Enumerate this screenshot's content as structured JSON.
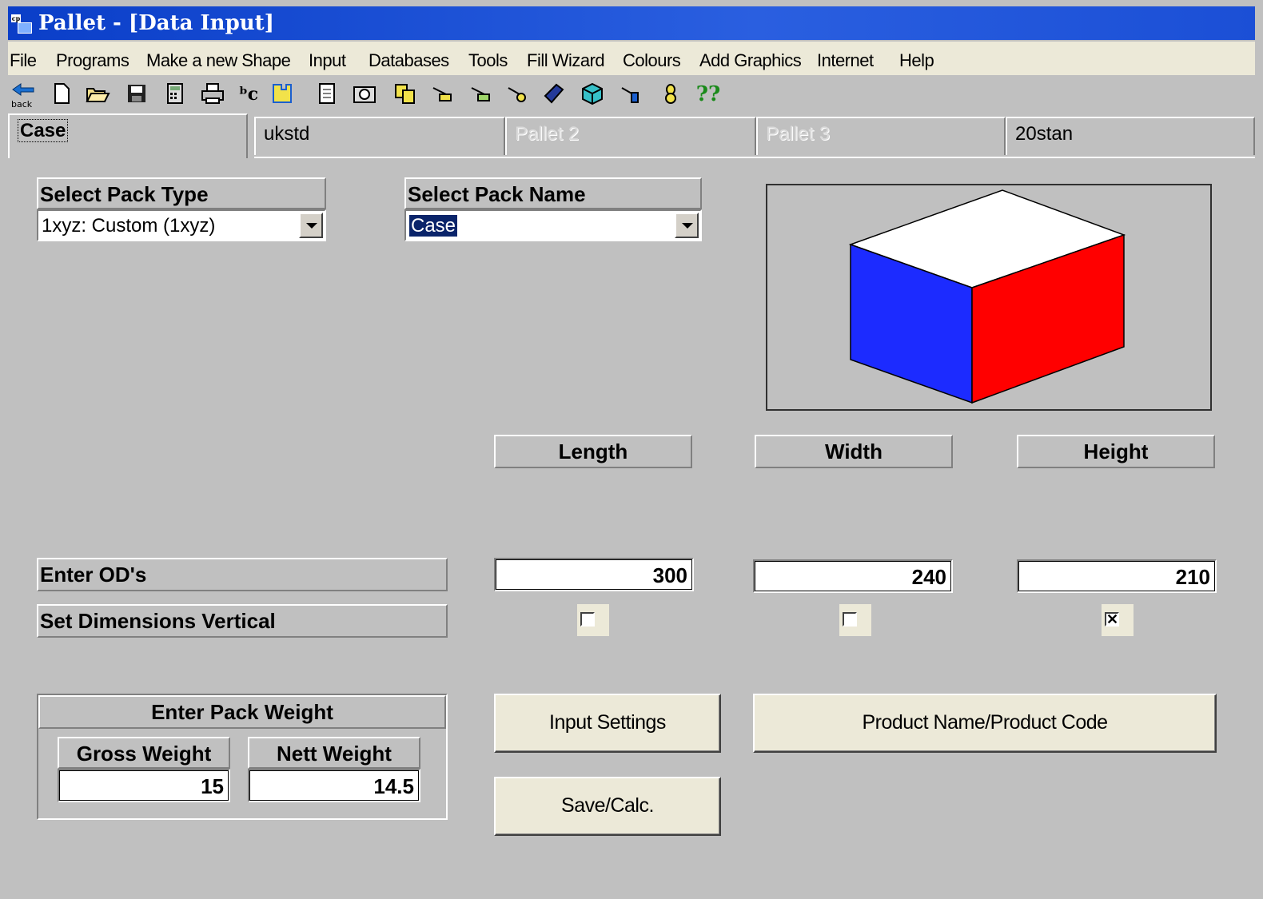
{
  "window": {
    "title": "Pallet - [Data Input]",
    "app_icon_text": "cp"
  },
  "menu": [
    "File",
    "Programs",
    "Make a new Shape",
    "Input",
    "Databases",
    "Tools",
    "Fill Wizard",
    "Colours",
    "Add Graphics",
    "Internet",
    "Help"
  ],
  "toolbar": {
    "back_label": "back",
    "icons": [
      "new-file-icon",
      "open-folder-icon",
      "save-disk-icon",
      "calculator-icon",
      "print-icon",
      "spell-abc-icon",
      "puzzle-icon",
      "document-icon",
      "camera-icon",
      "copy-icon",
      "pallet-tool-icon",
      "pallet-tool-2-icon",
      "pallet-tool-3-icon",
      "book-icon",
      "box-3d-icon",
      "pallet-tool-4-icon",
      "bottle-icon",
      "help-icon"
    ],
    "help_text": "??"
  },
  "tabs": [
    {
      "label": "Case",
      "state": "active"
    },
    {
      "label": "ukstd",
      "state": "normal"
    },
    {
      "label": "Pallet 2",
      "state": "disabled"
    },
    {
      "label": "Pallet 3",
      "state": "disabled"
    },
    {
      "label": "20stan",
      "state": "normal"
    }
  ],
  "pack_type": {
    "header": "Select Pack Type",
    "value": "1xyz:  Custom (1xyz)"
  },
  "pack_name": {
    "header": "Select Pack Name",
    "value": "Case"
  },
  "preview_colors": {
    "top": "#ffffff",
    "left": "#1c2bff",
    "right": "#ff0000"
  },
  "dimensions": {
    "headers": [
      "Length",
      "Width",
      "Height"
    ],
    "od_label": "Enter OD's",
    "od_values": [
      "300",
      "240",
      "210"
    ],
    "vertical_label": "Set Dimensions Vertical",
    "vertical_checked": [
      false,
      false,
      true
    ]
  },
  "weight": {
    "header": "Enter Pack Weight",
    "gross_label": "Gross Weight",
    "gross_value": "15",
    "nett_label": "Nett Weight",
    "nett_value": "14.5"
  },
  "buttons": {
    "input_settings": "Input Settings",
    "product_name": "Product Name/Product Code",
    "save_calc": "Save/Calc."
  }
}
